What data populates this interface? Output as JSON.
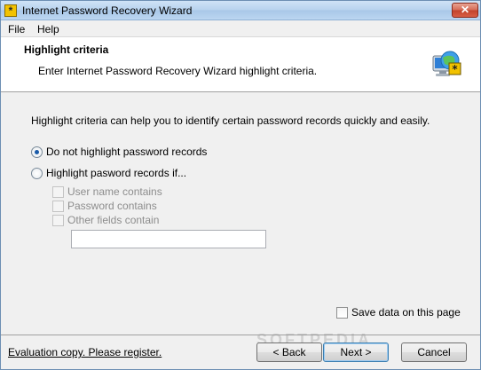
{
  "window": {
    "title": "Internet Password Recovery Wizard",
    "close_label": "✕"
  },
  "menu": {
    "items": [
      "File",
      "Help"
    ]
  },
  "header": {
    "title": "Highlight criteria",
    "subtitle": "Enter Internet Password Recovery Wizard highlight criteria."
  },
  "body": {
    "intro": "Highlight criteria can help you to identify certain password records quickly and easily.",
    "radio_options": [
      {
        "label": "Do not highlight password records",
        "checked": true
      },
      {
        "label": "Highlight pasword records if...",
        "checked": false
      }
    ],
    "criteria_checks": [
      {
        "label": "User name contains",
        "checked": false,
        "enabled": false
      },
      {
        "label": "Password contains",
        "checked": false,
        "enabled": false
      },
      {
        "label": "Other fields contain",
        "checked": false,
        "enabled": false
      }
    ],
    "criteria_input": {
      "value": "",
      "placeholder": ""
    },
    "save_data_label": "Save data on this page",
    "save_data_checked": false
  },
  "footer": {
    "register_link": "Evaluation copy. Please register.",
    "back_label": "< Back",
    "next_label": "Next >",
    "cancel_label": "Cancel",
    "watermark": "SOFTPEDIA"
  },
  "icons": {
    "app": "password-key-icon",
    "header": "globe-monitor-icon"
  },
  "colors": {
    "radio_dot": "#1a5aa8",
    "close_button": "#c2422b",
    "header_bg": "#ffffff"
  }
}
